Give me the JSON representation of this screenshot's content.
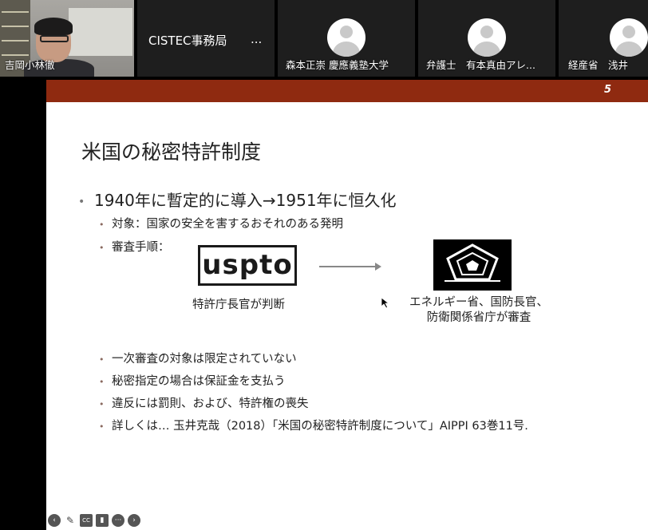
{
  "participants": {
    "camera_tile": {
      "name": "吉岡小林徹"
    },
    "host_tile": {
      "name": "CISTEC事務局",
      "ellipsis": "..."
    },
    "tiles": [
      {
        "name": "森本正崇 慶應義塾大学"
      },
      {
        "name": "弁護士　有本真由アレ..."
      },
      {
        "name": "経産省　浅井"
      }
    ]
  },
  "slide": {
    "page_number": "5",
    "title": "米国の秘密特許制度",
    "bullet_main": "1940年に暫定的に導入→1951年に恒久化",
    "bullets_sub_top": [
      "対象：国家の安全を害するおそれのある発明",
      "審査手順："
    ],
    "uspto_logo_text": "uspto",
    "caption_left": "特許庁長官が判断",
    "caption_right_line1": "エネルギー省、国防長官、",
    "caption_right_line2": "防衛関係省庁が審査",
    "bullets_sub_bottom": [
      "一次審査の対象は限定されていない",
      "秘密指定の場合は保証金を支払う",
      "違反には罰則、および、特許権の喪失",
      "詳しくは… 玉井克哉（2018）「米国の秘密特許制度について」AIPPI 63巻11号."
    ],
    "accent_color": "#8f2a10"
  },
  "toolbar": {
    "icons": [
      "back-icon",
      "pen-icon",
      "cc-icon",
      "video-off-icon",
      "more-icon",
      "forward-icon"
    ],
    "cc_label": "CC"
  }
}
